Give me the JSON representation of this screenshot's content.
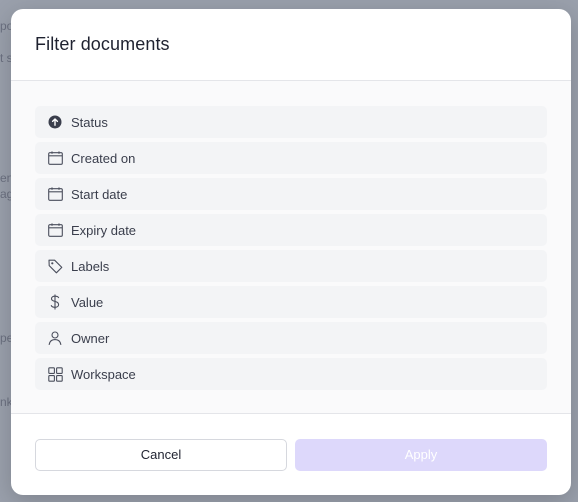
{
  "background": {
    "fragments": [
      "po",
      "t s",
      "en",
      "ag",
      "pe",
      "nk"
    ]
  },
  "modal": {
    "title": "Filter documents",
    "filters": [
      {
        "label": "Status",
        "icon": "status-arrow-up-icon"
      },
      {
        "label": "Created on",
        "icon": "calendar-icon"
      },
      {
        "label": "Start date",
        "icon": "calendar-icon"
      },
      {
        "label": "Expiry date",
        "icon": "calendar-icon"
      },
      {
        "label": "Labels",
        "icon": "tag-icon"
      },
      {
        "label": "Value",
        "icon": "dollar-icon"
      },
      {
        "label": "Owner",
        "icon": "user-icon"
      },
      {
        "label": "Workspace",
        "icon": "grid-icon"
      }
    ],
    "cancel_label": "Cancel",
    "apply_label": "Apply"
  },
  "colors": {
    "overlay": "#9aa0ac",
    "apply_disabled": "#ddd8fb",
    "item_background": "#f3f4f6"
  }
}
